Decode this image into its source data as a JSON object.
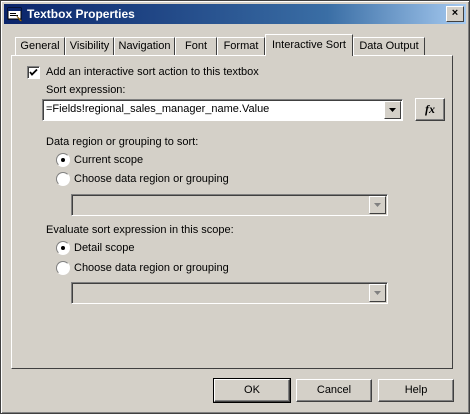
{
  "window": {
    "title": "Textbox Properties"
  },
  "tabs": [
    {
      "label": "General"
    },
    {
      "label": "Visibility"
    },
    {
      "label": "Navigation"
    },
    {
      "label": "Font"
    },
    {
      "label": "Format"
    },
    {
      "label": "Interactive Sort"
    },
    {
      "label": "Data Output"
    }
  ],
  "active_tab": "Interactive Sort",
  "sort": {
    "checkbox_label": "Add an interactive sort action to this textbox",
    "checkbox_checked": true,
    "expression_label": "Sort expression:",
    "expression_value": "=Fields!regional_sales_manager_name.Value",
    "fx_label": "fx"
  },
  "data_region": {
    "heading": "Data region or grouping to sort:",
    "option1": "Current scope",
    "option2": "Choose data region or grouping",
    "selected": "Current scope"
  },
  "evaluate": {
    "heading": "Evaluate sort expression in this scope:",
    "option1": "Detail scope",
    "option2": "Choose data region or grouping",
    "selected": "Detail scope"
  },
  "buttons": {
    "ok": "OK",
    "cancel": "Cancel",
    "help": "Help"
  }
}
